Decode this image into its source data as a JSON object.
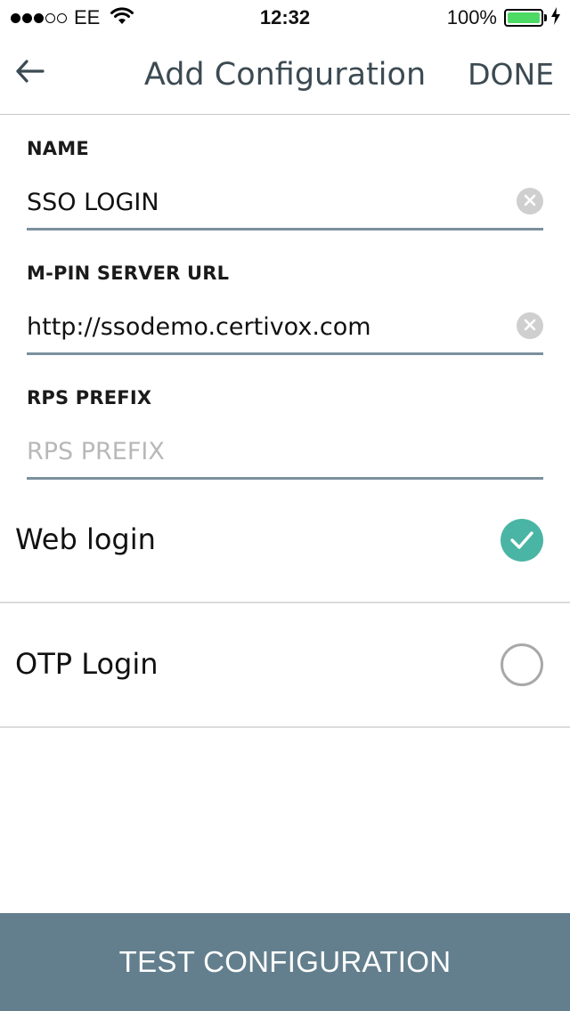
{
  "status_bar": {
    "signal_dots": {
      "filled": 3,
      "total": 5
    },
    "carrier": "EE",
    "wifi_icon": "wifi-icon",
    "time": "12:32",
    "battery_percent": "100%",
    "battery_level": 1.0,
    "battery_color": "#4cd964",
    "charging_icon": "bolt-icon"
  },
  "nav": {
    "back_icon": "arrow-left-icon",
    "title": "Add Configuration",
    "done_label": "DONE"
  },
  "form": {
    "name": {
      "label": "NAME",
      "value": "SSO LOGIN",
      "clear_icon": "clear-icon"
    },
    "server_url": {
      "label": "M-PIN SERVER URL",
      "value": "http://ssodemo.certivox.com",
      "clear_icon": "clear-icon"
    },
    "rps_prefix": {
      "label": "RPS PREFIX",
      "value": "",
      "placeholder": "RPS PREFIX"
    }
  },
  "options": [
    {
      "label": "Web login",
      "selected": true
    },
    {
      "label": "OTP Login",
      "selected": false
    }
  ],
  "colors": {
    "accent": "#4ab5a4",
    "input_underline": "#7b909d",
    "bottom_button": "#637f8d"
  },
  "footer": {
    "test_button_label": "TEST CONFIGURATION"
  }
}
